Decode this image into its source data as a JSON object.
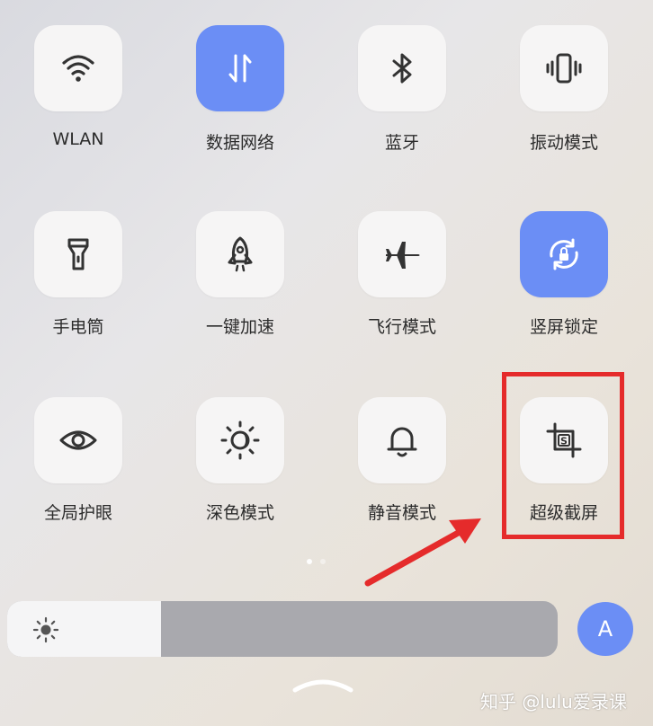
{
  "tiles": [
    {
      "label": "WLAN",
      "icon": "wifi-icon",
      "active": false
    },
    {
      "label": "数据网络",
      "icon": "data-network-icon",
      "active": true
    },
    {
      "label": "蓝牙",
      "icon": "bluetooth-icon",
      "active": false
    },
    {
      "label": "振动模式",
      "icon": "vibrate-icon",
      "active": false
    },
    {
      "label": "手电筒",
      "icon": "flashlight-icon",
      "active": false
    },
    {
      "label": "一键加速",
      "icon": "rocket-icon",
      "active": false
    },
    {
      "label": "飞行模式",
      "icon": "airplane-icon",
      "active": false
    },
    {
      "label": "竖屏锁定",
      "icon": "rotation-lock-icon",
      "active": true
    },
    {
      "label": "全局护眼",
      "icon": "eye-icon",
      "active": false
    },
    {
      "label": "深色模式",
      "icon": "dark-mode-icon",
      "active": false
    },
    {
      "label": "静音模式",
      "icon": "bell-icon",
      "active": false
    },
    {
      "label": "超级截屏",
      "icon": "super-screenshot-icon",
      "active": false
    }
  ],
  "page_dots": {
    "count": 2,
    "current": 1
  },
  "brightness": {
    "level": 0.28,
    "icon": "sun-icon"
  },
  "auto_brightness": {
    "label": "A"
  },
  "watermark": "知乎 @lulu爱录课",
  "colors": {
    "accent": "#6b8ef5",
    "highlight": "#e52b2b",
    "tile": "#f6f5f5"
  }
}
